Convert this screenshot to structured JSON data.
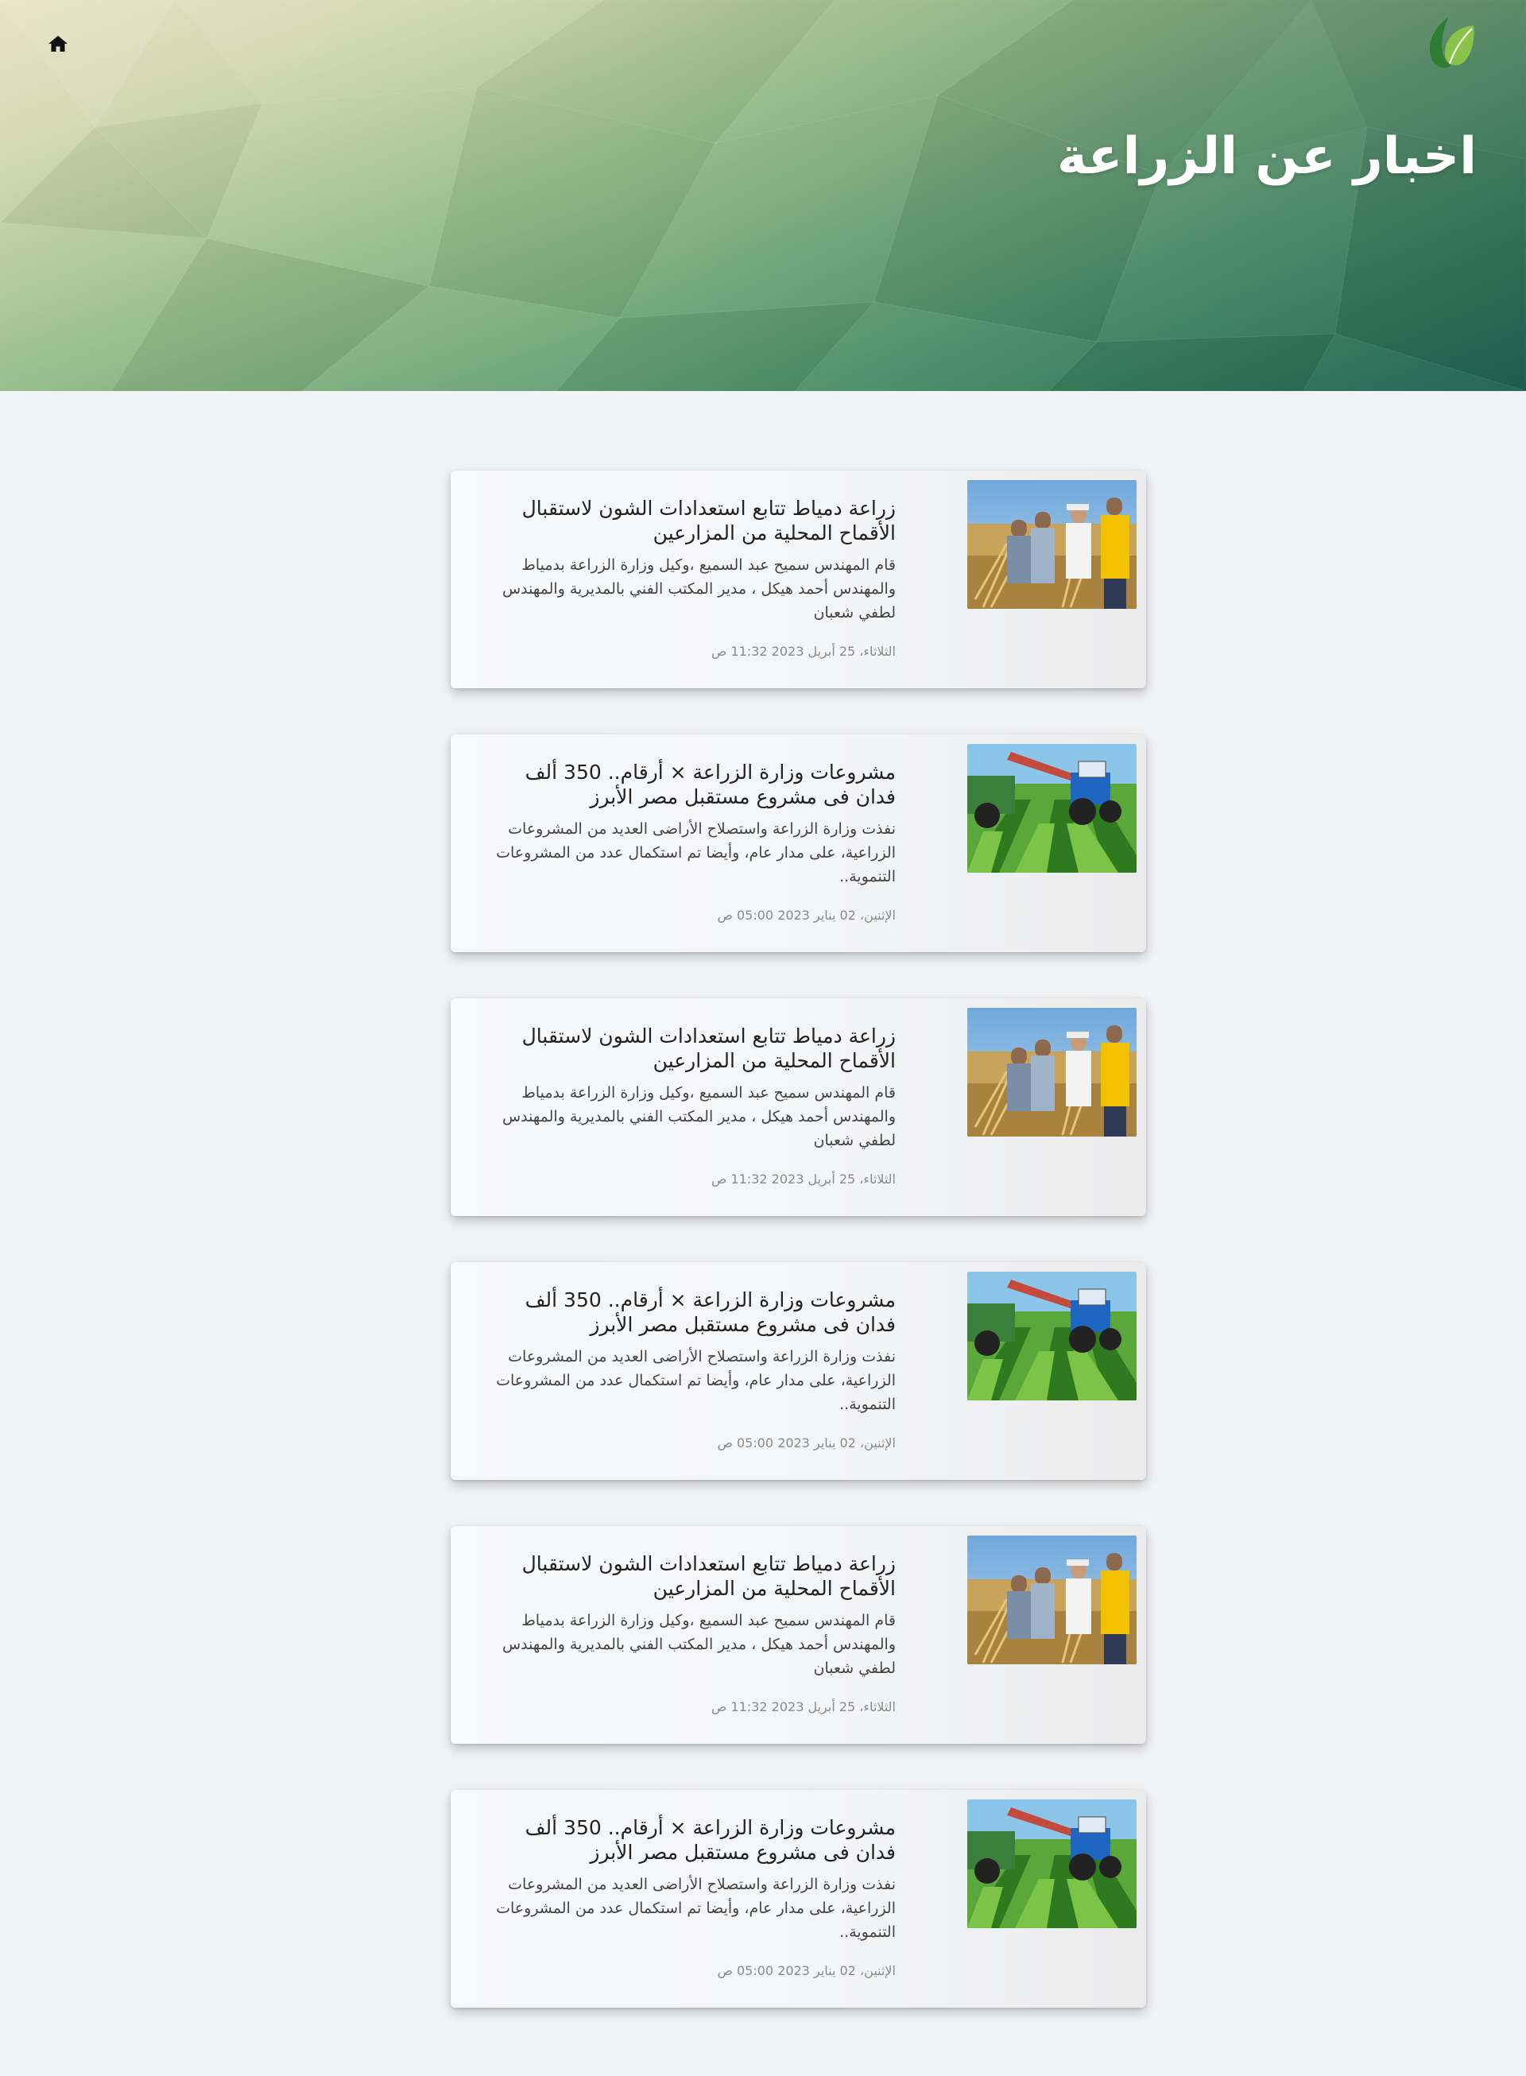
{
  "header": {
    "title": "اخبار عن الزراعة",
    "home_icon": "home-icon",
    "logo_icon": "leaf-logo-icon",
    "colors": {
      "leaf_dark": "#2e7d32",
      "leaf_light": "#8bc34a"
    }
  },
  "news": [
    {
      "title": "زراعة دمياط تتابع استعدادات الشون لاستقبال الأقماح المحلية من المزارعين",
      "excerpt": "قام المهندس سميح عبد السميع ،وكيل وزارة الزراعة بدمياط والمهندس أحمد هيكل ، مدير المكتب الفني بالمديرية والمهندس لطفي شعبان",
      "date": "الثلاثاء، 25 أبريل 2023 11:32 ص",
      "image": "wheat-harvest"
    },
    {
      "title": "مشروعات وزارة الزراعة × أرقام.. 350 ألف فدان فى مشروع مستقبل مصر الأبرز",
      "excerpt": "نفذت وزارة الزراعة واستصلاح الأراضى العديد من المشروعات الزراعية، على مدار عام، وأيضا تم استكمال عدد من المشروعات التنموية..",
      "date": "الإثنين، 02 يناير 2023 05:00 ص",
      "image": "tractor-field"
    },
    {
      "title": "زراعة دمياط تتابع استعدادات الشون لاستقبال الأقماح المحلية من المزارعين",
      "excerpt": "قام المهندس سميح عبد السميع ،وكيل وزارة الزراعة بدمياط والمهندس أحمد هيكل ، مدير المكتب الفني بالمديرية والمهندس لطفي شعبان",
      "date": "الثلاثاء، 25 أبريل 2023 11:32 ص",
      "image": "wheat-harvest"
    },
    {
      "title": "مشروعات وزارة الزراعة × أرقام.. 350 ألف فدان فى مشروع مستقبل مصر الأبرز",
      "excerpt": "نفذت وزارة الزراعة واستصلاح الأراضى العديد من المشروعات الزراعية، على مدار عام، وأيضا تم استكمال عدد من المشروعات التنموية..",
      "date": "الإثنين، 02 يناير 2023 05:00 ص",
      "image": "tractor-field"
    },
    {
      "title": "زراعة دمياط تتابع استعدادات الشون لاستقبال الأقماح المحلية من المزارعين",
      "excerpt": "قام المهندس سميح عبد السميع ،وكيل وزارة الزراعة بدمياط والمهندس أحمد هيكل ، مدير المكتب الفني بالمديرية والمهندس لطفي شعبان",
      "date": "الثلاثاء، 25 أبريل 2023 11:32 ص",
      "image": "wheat-harvest"
    },
    {
      "title": "مشروعات وزارة الزراعة × أرقام.. 350 ألف فدان فى مشروع مستقبل مصر الأبرز",
      "excerpt": "نفذت وزارة الزراعة واستصلاح الأراضى العديد من المشروعات الزراعية، على مدار عام، وأيضا تم استكمال عدد من المشروعات التنموية..",
      "date": "الإثنين، 02 يناير 2023 05:00 ص",
      "image": "tractor-field"
    }
  ]
}
